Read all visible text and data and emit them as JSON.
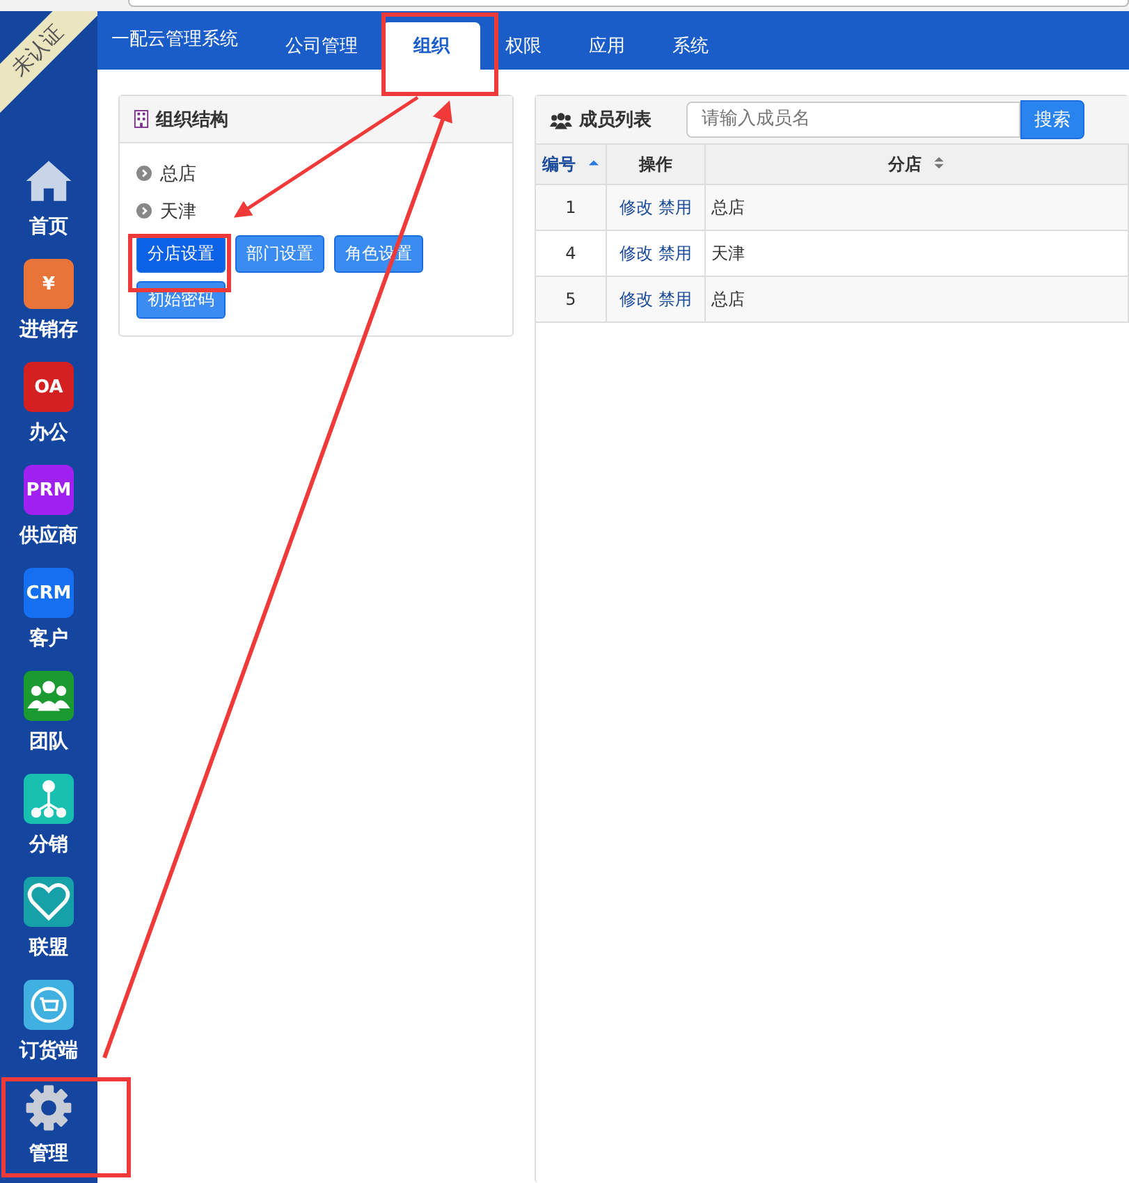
{
  "ribbon": {
    "text": "未认证"
  },
  "sidebar": {
    "items": [
      {
        "label": "首页",
        "kind": "home"
      },
      {
        "label": "进销存",
        "kind": "glyph",
        "glyph": "¥",
        "color": "#e8743a"
      },
      {
        "label": "办公",
        "kind": "glyph",
        "glyph": "OA",
        "color": "#d42020"
      },
      {
        "label": "供应商",
        "kind": "glyph",
        "glyph": "PRM",
        "color": "#a020f0"
      },
      {
        "label": "客户",
        "kind": "glyph",
        "glyph": "CRM",
        "color": "#1470f0"
      },
      {
        "label": "团队",
        "kind": "team",
        "color": "#1a9a30"
      },
      {
        "label": "分销",
        "kind": "tree",
        "color": "#18c0b0"
      },
      {
        "label": "联盟",
        "kind": "heart",
        "color": "#16a0a8"
      },
      {
        "label": "订货端",
        "kind": "cart",
        "color": "#40b0e0"
      },
      {
        "label": "管理",
        "kind": "gear"
      }
    ]
  },
  "topnav": {
    "brand": "一配云管理系统",
    "tabs": [
      {
        "label": "公司管理",
        "selected": false
      },
      {
        "label": "组织",
        "selected": true
      },
      {
        "label": "权限",
        "selected": false
      },
      {
        "label": "应用",
        "selected": false
      },
      {
        "label": "系统",
        "selected": false
      }
    ]
  },
  "org_panel": {
    "title": "组织结构",
    "tree": [
      "总店",
      "天津"
    ],
    "buttons": [
      {
        "label": "分店设置",
        "selected": true
      },
      {
        "label": "部门设置",
        "selected": false
      },
      {
        "label": "角色设置",
        "selected": false
      },
      {
        "label": "初始密码",
        "selected": false
      }
    ]
  },
  "member_panel": {
    "title": "成员列表",
    "search": {
      "placeholder": "请输入成员名"
    },
    "search_button": "搜索",
    "table": {
      "columns": [
        {
          "label": "编号",
          "sortable": true,
          "sorted": true
        },
        {
          "label": "操作",
          "sortable": false,
          "sorted": false
        },
        {
          "label": "分店",
          "sortable": true,
          "sorted": false
        }
      ],
      "rows": [
        {
          "id": "1",
          "actions": [
            "修改",
            "禁用"
          ],
          "branch": "总店"
        },
        {
          "id": "4",
          "actions": [
            "修改",
            "禁用"
          ],
          "branch": "天津"
        },
        {
          "id": "5",
          "actions": [
            "修改",
            "禁用"
          ],
          "branch": "总店"
        }
      ]
    }
  }
}
